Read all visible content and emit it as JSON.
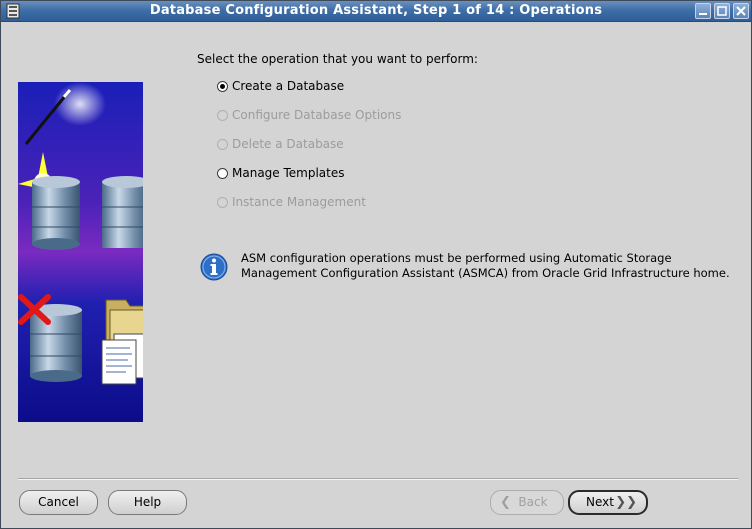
{
  "window": {
    "title": "Database Configuration Assistant, Step 1 of 14 : Operations"
  },
  "content": {
    "prompt": "Select the operation that you want to perform:",
    "operations": [
      {
        "label": "Create a Database",
        "selected": true,
        "enabled": true
      },
      {
        "label": "Configure Database Options",
        "selected": false,
        "enabled": false
      },
      {
        "label": "Delete a Database",
        "selected": false,
        "enabled": false
      },
      {
        "label": "Manage Templates",
        "selected": false,
        "enabled": true
      },
      {
        "label": "Instance Management",
        "selected": false,
        "enabled": false
      }
    ],
    "info": {
      "icon": "info-icon",
      "line1": "ASM configuration operations must be performed using Automatic Storage",
      "line2": "Management Configuration Assistant (ASMCA) from Oracle Grid Infrastructure home."
    }
  },
  "buttons": {
    "cancel": "Cancel",
    "help": "Help",
    "back": "Back",
    "next": "Next"
  },
  "colors": {
    "titlebar": "#3f6fa8",
    "background": "#d4d4d4",
    "disabled_text": "#9c9c9c",
    "info_blue": "#2e6fc8"
  }
}
